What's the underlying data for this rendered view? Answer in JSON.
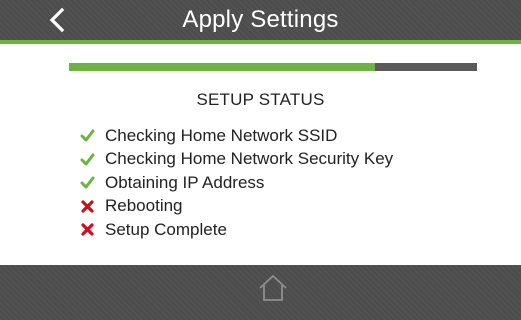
{
  "header": {
    "title": "Apply Settings",
    "back_icon": "chevron-left-icon"
  },
  "progress": {
    "percent": 75,
    "fill_color": "#6cb33f",
    "track_color": "#5a5a5a"
  },
  "status": {
    "heading": "SETUP STATUS",
    "steps": [
      {
        "label": "Checking Home Network SSID",
        "state": "done",
        "icon": "check-icon"
      },
      {
        "label": "Checking Home Network Security Key",
        "state": "done",
        "icon": "check-icon"
      },
      {
        "label": "Obtaining IP Address",
        "state": "done",
        "icon": "check-icon"
      },
      {
        "label": "Rebooting",
        "state": "pending",
        "icon": "x-icon"
      },
      {
        "label": "Setup Complete",
        "state": "pending",
        "icon": "x-icon"
      }
    ]
  },
  "footer": {
    "home_icon": "home-icon"
  },
  "colors": {
    "accent": "#6cb33f",
    "bar": "#4d4d4d",
    "check": "#6cb33f",
    "cross": "#c8101e"
  }
}
